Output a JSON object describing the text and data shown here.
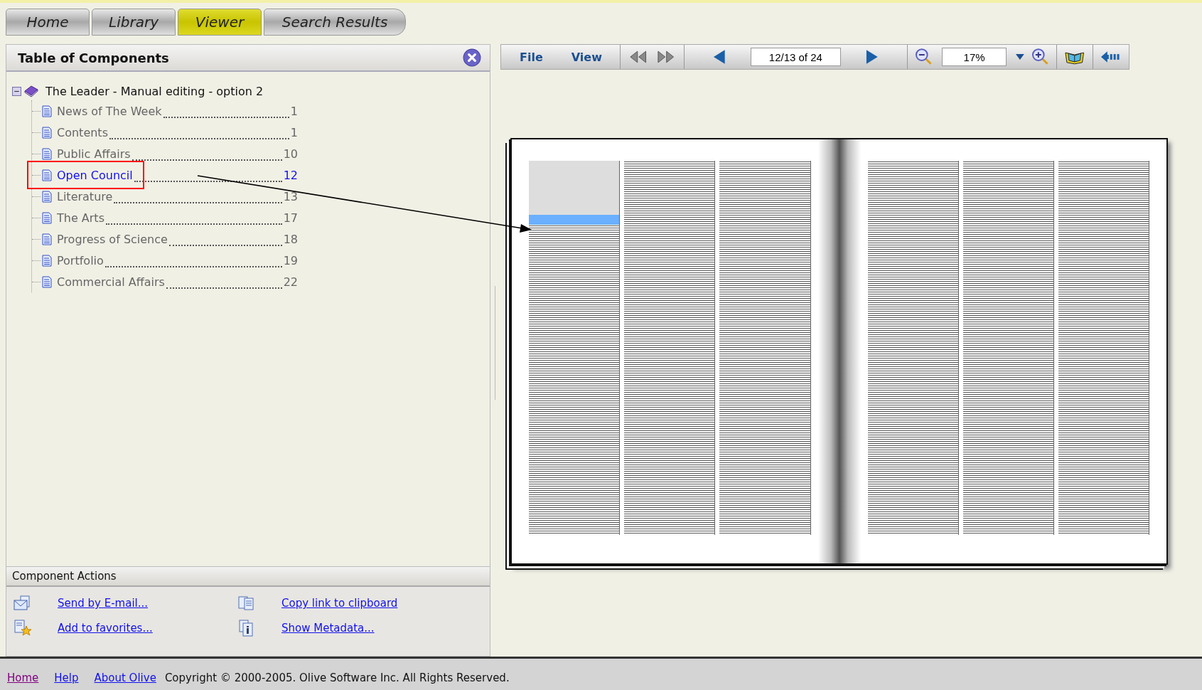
{
  "tabs": [
    {
      "label": "Home",
      "selected": false
    },
    {
      "label": "Library",
      "selected": false
    },
    {
      "label": "Viewer",
      "selected": true
    },
    {
      "label": "Search Results",
      "selected": false
    }
  ],
  "toc_panel": {
    "title": "Table of Components",
    "root": {
      "label": "The Leader - Manual editing - option 2",
      "expanded": true,
      "children": [
        {
          "label": "News of The Week",
          "page": "1",
          "selected": false
        },
        {
          "label": "Contents",
          "page": "1",
          "selected": false
        },
        {
          "label": "Public Affairs",
          "page": "10",
          "selected": false
        },
        {
          "label": "Open Council",
          "page": "12",
          "selected": true
        },
        {
          "label": "Literature",
          "page": "13",
          "selected": false
        },
        {
          "label": "The Arts",
          "page": "17",
          "selected": false
        },
        {
          "label": "Progress of Science",
          "page": "18",
          "selected": false
        },
        {
          "label": "Portfolio",
          "page": "19",
          "selected": false
        },
        {
          "label": "Commercial Affairs",
          "page": "22",
          "selected": false
        }
      ]
    }
  },
  "component_actions": {
    "title": "Component Actions",
    "items": [
      {
        "kind": "email",
        "label": "Send by E-mail..."
      },
      {
        "kind": "copy",
        "label": "Copy link to clipboard"
      },
      {
        "kind": "favorite",
        "label": "Add to favorites..."
      },
      {
        "kind": "metadata",
        "label": "Show Metadata..."
      }
    ]
  },
  "toolbar": {
    "menus": [
      "File",
      "View"
    ],
    "page_field": "12/13 of 24",
    "zoom_field": "17%"
  },
  "footer": {
    "links": [
      {
        "label": "Home",
        "visited": true
      },
      {
        "label": "Help",
        "visited": false
      },
      {
        "label": "About Olive",
        "visited": false
      }
    ],
    "copyright": "Copyright © 2000-2005. Olive Software Inc. All Rights Reserved."
  }
}
